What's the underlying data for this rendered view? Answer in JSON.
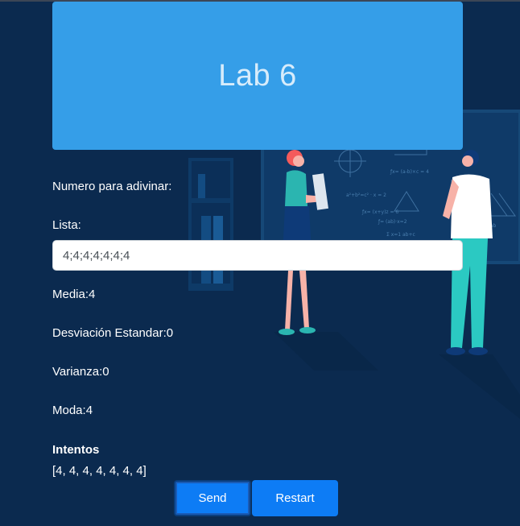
{
  "header": {
    "title": "Lab 6"
  },
  "form": {
    "guess_label": "Numero para adivinar:",
    "list_label": "Lista:",
    "list_value": "4;4;4;4;4;4;4"
  },
  "stats": {
    "media": "Media:4",
    "desviacion": "Desviación Estandar:0",
    "varianza": "Varianza:0",
    "moda": "Moda:4"
  },
  "attempts": {
    "title": "Intentos",
    "values": "[4, 4, 4, 4, 4, 4, 4]"
  },
  "buttons": {
    "send": "Send",
    "restart": "Restart"
  },
  "colors": {
    "background": "#0b2a4f",
    "header": "#359ee8",
    "button": "#0d7cf5"
  },
  "illustration": {
    "icons": [
      "teacher-illustration",
      "student-illustration",
      "blackboard-illustration",
      "bookshelf-illustration"
    ]
  }
}
